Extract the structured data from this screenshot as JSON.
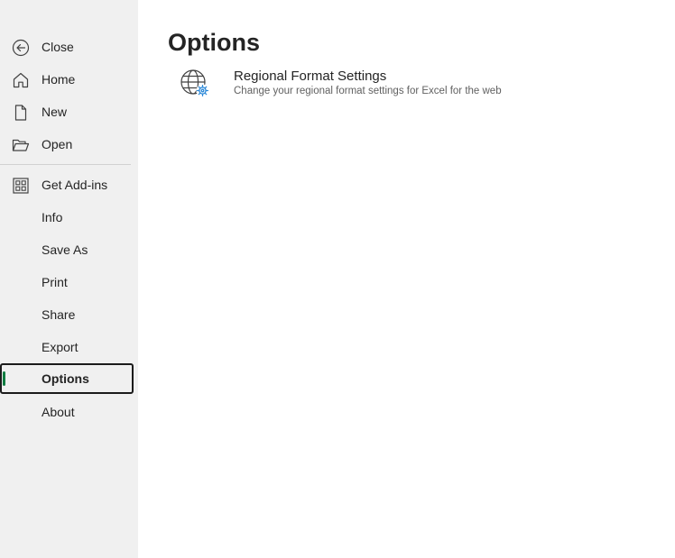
{
  "sidebar": {
    "items": [
      {
        "label": "Close",
        "icon": "back-arrow-icon"
      },
      {
        "label": "Home",
        "icon": "home-icon"
      },
      {
        "label": "New",
        "icon": "new-document-icon"
      },
      {
        "label": "Open",
        "icon": "open-folder-icon"
      },
      {
        "label": "Get Add-ins",
        "icon": "add-ins-icon"
      },
      {
        "label": "Info"
      },
      {
        "label": "Save As"
      },
      {
        "label": "Print"
      },
      {
        "label": "Share"
      },
      {
        "label": "Export"
      },
      {
        "label": "Options",
        "selected": true
      },
      {
        "label": "About"
      }
    ]
  },
  "main": {
    "title": "Options",
    "options": [
      {
        "title": "Regional Format Settings",
        "description": "Change your regional format settings for Excel for the web",
        "icon": "globe-gear-icon"
      }
    ]
  },
  "colors": {
    "sidebar_bg": "#f0f0f0",
    "accent_green": "#107c41",
    "icon_blue": "#2b88d8",
    "text": "#242424",
    "secondary_text": "#616161"
  }
}
